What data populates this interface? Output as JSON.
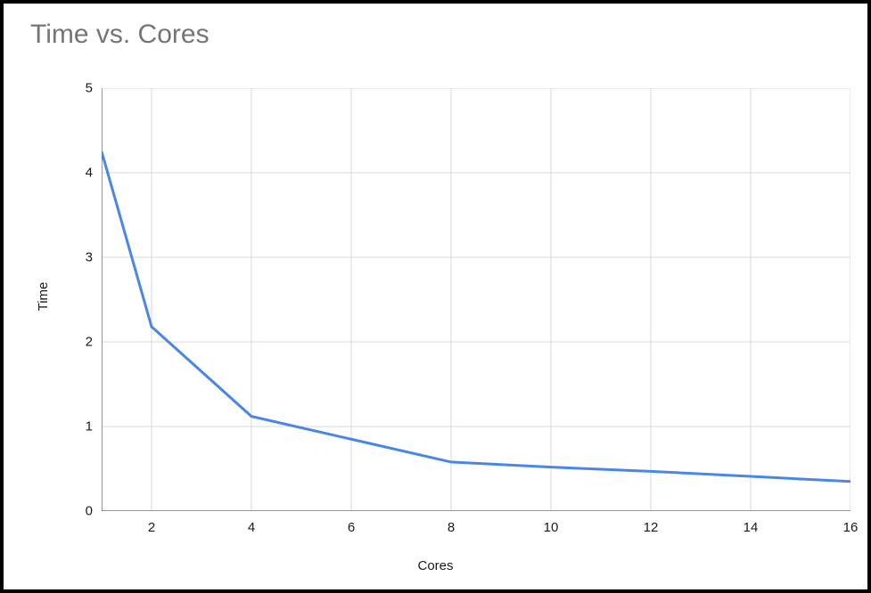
{
  "chart_data": {
    "type": "line",
    "title": "Time vs. Cores",
    "xlabel": "Cores",
    "ylabel": "Time",
    "x": [
      1,
      2,
      4,
      6,
      8,
      10,
      12,
      14,
      16
    ],
    "values": [
      4.25,
      2.18,
      1.12,
      0.85,
      0.58,
      0.52,
      0.47,
      0.41,
      0.35
    ],
    "xlim": [
      1,
      16
    ],
    "ylim": [
      0,
      5
    ],
    "xticks": [
      2,
      4,
      6,
      8,
      10,
      12,
      14,
      16
    ],
    "yticks": [
      0,
      1,
      2,
      3,
      4,
      5
    ],
    "line_color": "#4a86e8",
    "grid": true
  }
}
